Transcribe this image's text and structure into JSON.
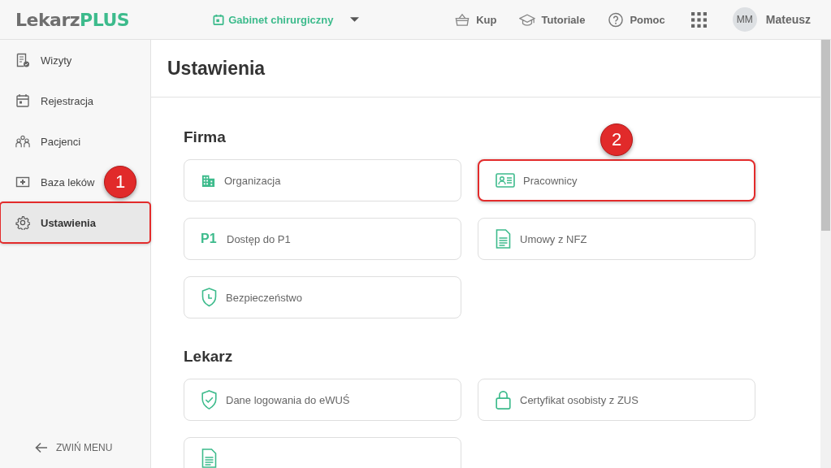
{
  "logo": {
    "part_1": "Lekarz",
    "part_2": "PLUS"
  },
  "clinic_selector": {
    "label": "Gabinet chirurgiczny"
  },
  "top_actions": [
    {
      "kind": "basket",
      "label": "Kup"
    },
    {
      "kind": "cap",
      "label": "Tutoriale"
    },
    {
      "kind": "help",
      "label": "Pomoc"
    }
  ],
  "user": {
    "initials": "MM",
    "name": "Mateusz"
  },
  "sidebar": {
    "items": [
      {
        "kind": "visits",
        "label": "Wizyty",
        "selected": false,
        "highlighted": false
      },
      {
        "kind": "calendar",
        "label": "Rejestracja",
        "selected": false,
        "highlighted": false
      },
      {
        "kind": "people",
        "label": "Pacjenci",
        "selected": false,
        "highlighted": false
      },
      {
        "kind": "medkit",
        "label": "Baza leków",
        "selected": false,
        "highlighted": false
      },
      {
        "kind": "gear",
        "label": "Ustawienia",
        "selected": true,
        "highlighted": true,
        "callout": "1"
      }
    ],
    "collapse": "ZWIŃ MENU"
  },
  "page_title": "Ustawienia",
  "sections": [
    {
      "title": "Firma",
      "cards": [
        {
          "kind": "building",
          "label": "Organizacja",
          "highlighted": false
        },
        {
          "kind": "idcard",
          "label": "Pracownicy",
          "highlighted": true,
          "callout": "2"
        },
        {
          "kind": "text",
          "badge": "P1",
          "label": "Dostęp do P1",
          "highlighted": false
        },
        {
          "kind": "document",
          "label": "Umowy z NFZ",
          "highlighted": false
        },
        {
          "kind": "shieldclock",
          "label": "Bezpieczeństwo",
          "highlighted": false
        }
      ]
    },
    {
      "title": "Lekarz",
      "cards": [
        {
          "kind": "shieldcheck",
          "label": "Dane logowania do eWUŚ",
          "highlighted": false
        },
        {
          "kind": "lock",
          "label": "Certyfikat osobisty z ZUS",
          "highlighted": false
        },
        {
          "kind": "document",
          "highlighted": false
        }
      ]
    }
  ]
}
